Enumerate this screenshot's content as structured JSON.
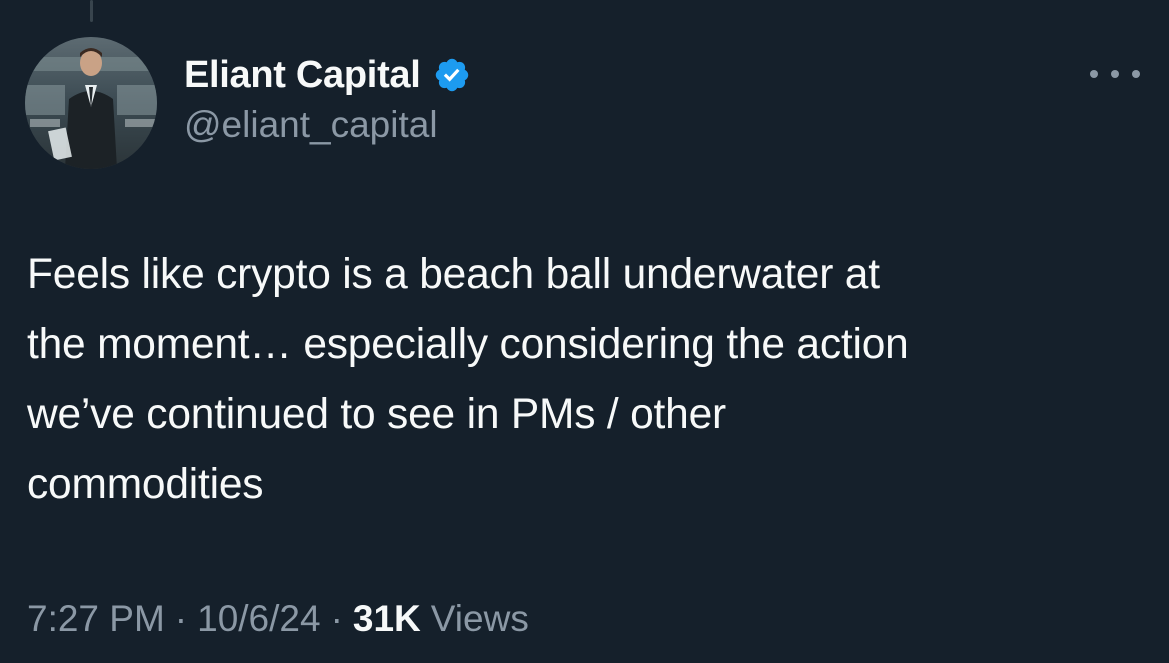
{
  "author": {
    "display_name": "Eliant Capital",
    "handle": "@eliant_capital",
    "verified": true,
    "avatar_icon": "profile-photo"
  },
  "tweet": {
    "text": "Feels like crypto is a beach ball underwater at\nthe moment… especially considering the action\nwe’ve continued to see in PMs / other\ncommodities"
  },
  "meta": {
    "time": "7:27 PM",
    "separator": "·",
    "date": "10/6/24",
    "views_count": "31K",
    "views_label": "Views"
  },
  "colors": {
    "background": "#15202b",
    "text_primary": "#f7f9f9",
    "text_secondary": "#8b98a5",
    "verified_blue": "#1d9bf0"
  },
  "icons": {
    "verified": "verified-badge-icon",
    "more": "more-icon"
  }
}
